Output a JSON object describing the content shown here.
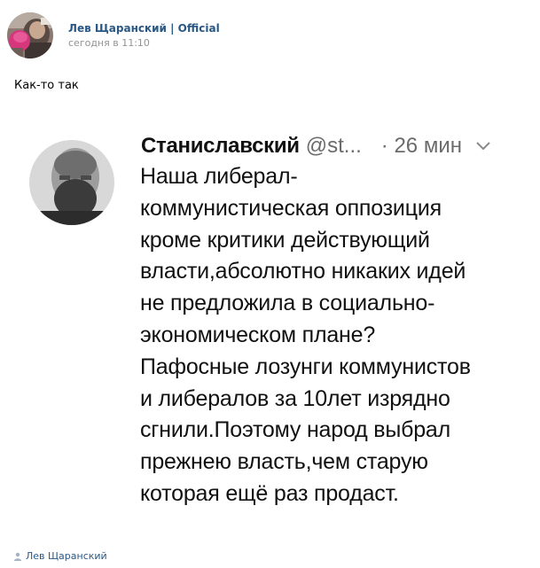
{
  "colors": {
    "link": "#2a5885",
    "muted": "#939393",
    "tweet_text": "#111111",
    "tweet_muted": "#6b6b6b"
  },
  "post": {
    "author_name": "Лев Щаранский | Official",
    "date": "сегодня в 11:10",
    "text": "Как-то так",
    "avatar_icon": "avatar-image"
  },
  "tweet": {
    "name": "Станиславский",
    "handle": "@st...",
    "time": "· 26 мин",
    "menu_icon": "chevron-down-icon",
    "lines": [
      "Наша либерал-",
      "коммунистическая оппозиция",
      "кроме критики действующий",
      "власти,абсолютно никаких идей",
      "не предложила в социально-",
      "экономическом плане?",
      "Пафосные лозунги коммунистов",
      "и либералов за 10лет изрядно",
      "сгнили.Поэтому народ выбрал",
      "прежнею власть,чем старую",
      "которая ещё раз продаст."
    ]
  },
  "footer": {
    "author_icon": "user-icon",
    "author": "Лев Щаранский"
  }
}
